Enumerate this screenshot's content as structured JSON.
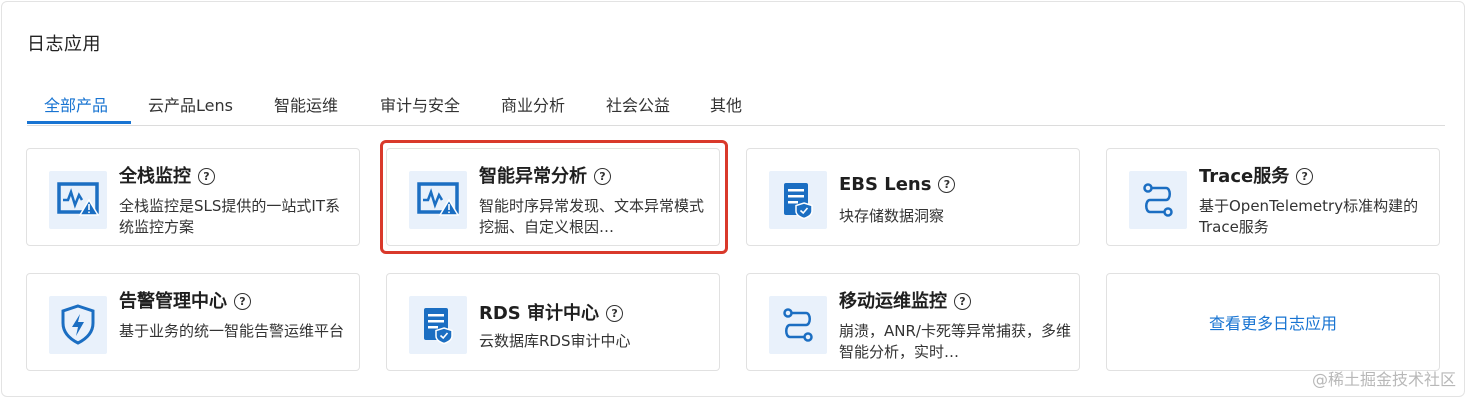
{
  "panel": {
    "title": "日志应用"
  },
  "tabs": [
    {
      "label": "全部产品",
      "active": true
    },
    {
      "label": "云产品Lens"
    },
    {
      "label": "智能运维"
    },
    {
      "label": "审计与安全"
    },
    {
      "label": "商业分析"
    },
    {
      "label": "社会公益"
    },
    {
      "label": "其他"
    }
  ],
  "cards": [
    {
      "title": "全栈监控",
      "desc": "全栈监控是SLS提供的一站式IT系统监控方案",
      "icon": "monitor-alert-icon",
      "help": "?"
    },
    {
      "title": "智能异常分析",
      "desc": "智能时序异常发现、文本异常模式挖掘、自定义根因…",
      "icon": "monitor-alert-icon",
      "help": "?"
    },
    {
      "title": "EBS Lens",
      "desc": "块存储数据洞察",
      "icon": "document-shield-icon",
      "help": "?"
    },
    {
      "title": "Trace服务",
      "desc": "基于OpenTelemetry标准构建的Trace服务",
      "icon": "trace-path-icon",
      "help": "?"
    },
    {
      "title": "告警管理中心",
      "desc": "基于业务的统一智能告警运维平台",
      "icon": "shield-bolt-icon",
      "help": "?"
    },
    {
      "title": "RDS 审计中心",
      "desc": "云数据库RDS审计中心",
      "icon": "document-shield-icon",
      "help": "?"
    },
    {
      "title": "移动运维监控",
      "desc": "崩溃，ANR/卡死等异常捕获，多维智能分析，实时…",
      "icon": "trace-path-icon",
      "help": "?"
    }
  ],
  "more_link": "查看更多日志应用",
  "highlight_color": "#d9392b",
  "accent_color": "#1874d2",
  "watermark": "@稀土掘金技术社区"
}
